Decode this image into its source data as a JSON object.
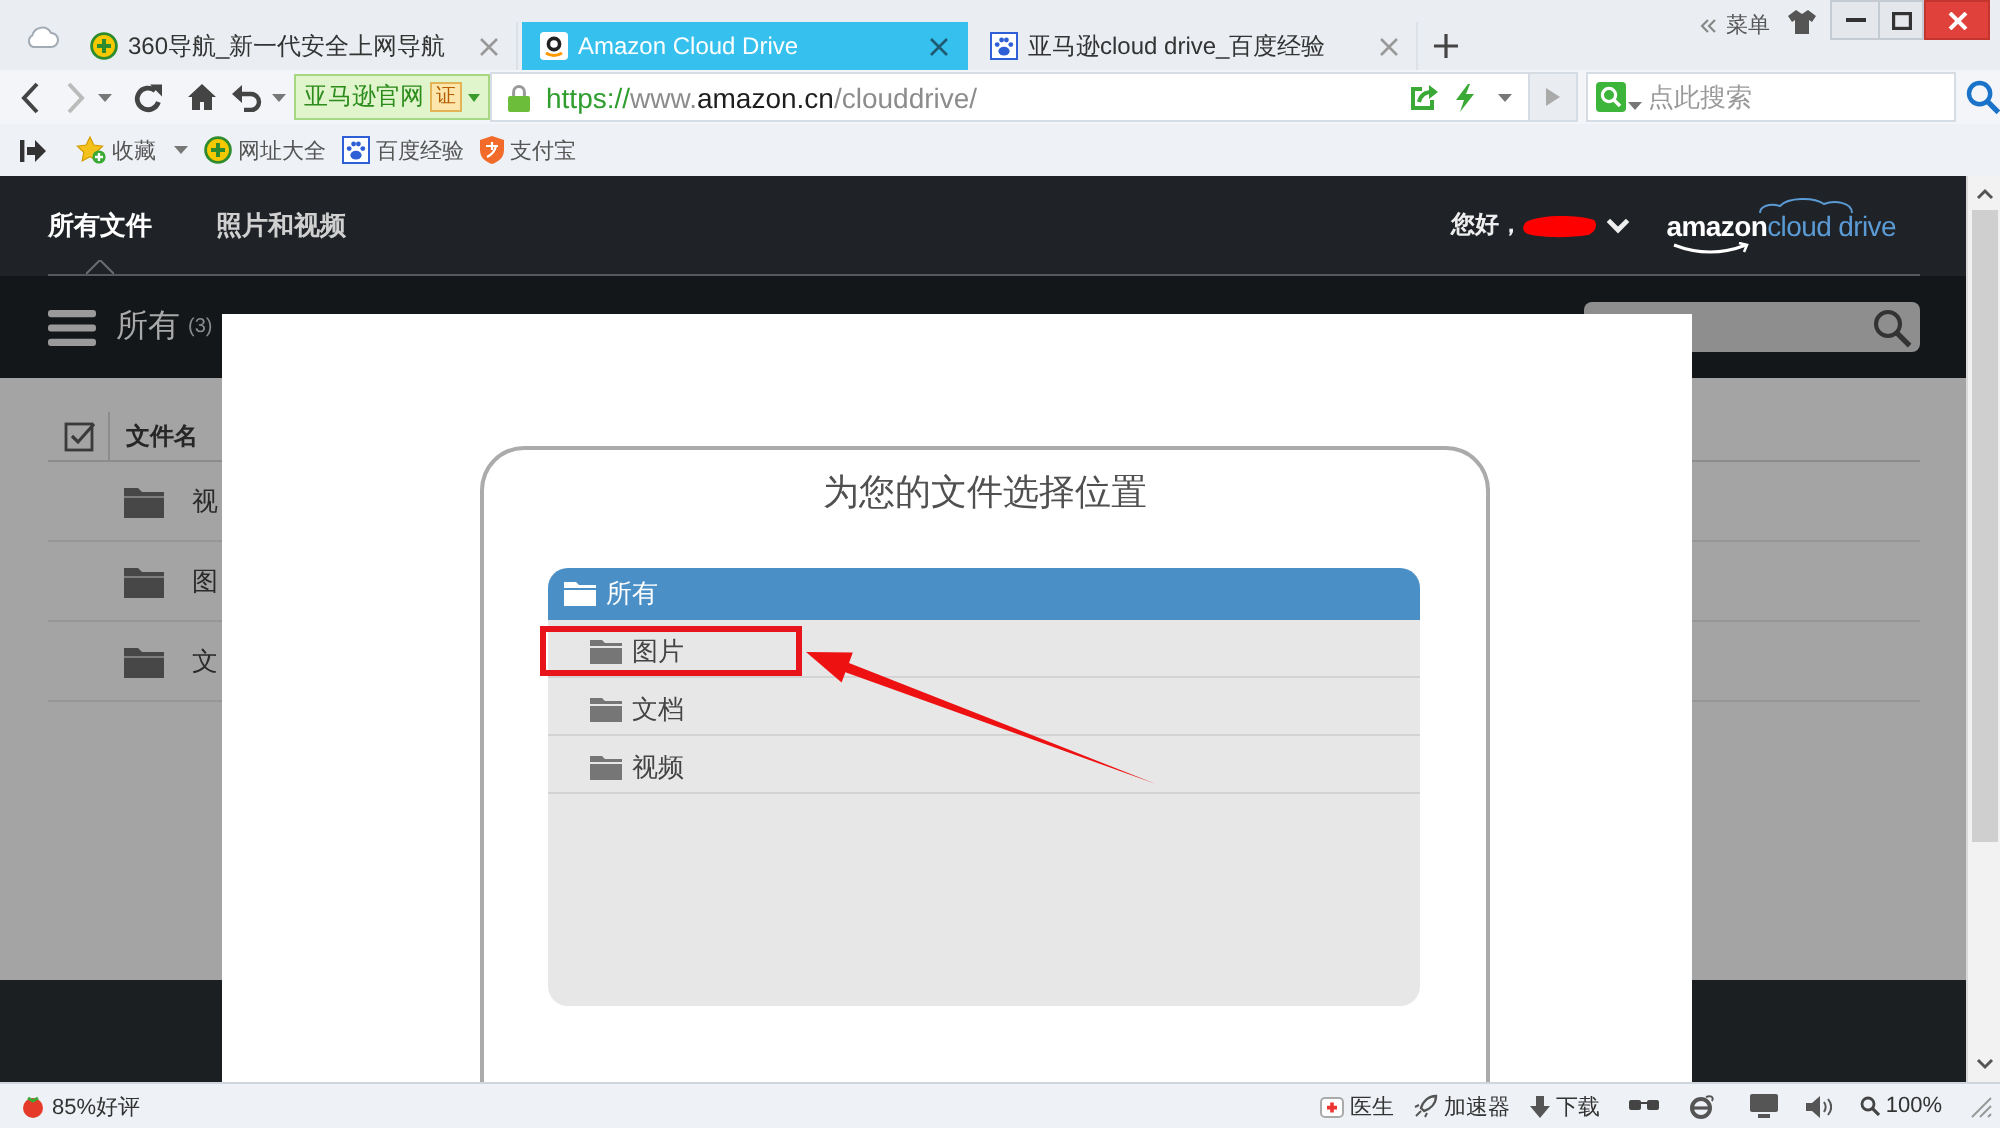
{
  "browser": {
    "tabs": [
      {
        "title": "360导航_新一代安全上网导航",
        "selected": false
      },
      {
        "title": "Amazon Cloud Drive",
        "selected": true
      },
      {
        "title": "亚马逊cloud drive_百度经验",
        "selected": false
      }
    ],
    "menu_label": "菜单",
    "nav_buttons": [
      {
        "kind": "back",
        "disabled": false
      },
      {
        "kind": "forward",
        "disabled": true
      }
    ],
    "site_badge": {
      "label": "亚马逊官网",
      "cert": "证"
    },
    "address": [
      {
        "text": "https://",
        "kind": "scheme"
      },
      {
        "text": "www.",
        "kind": "subdomain"
      },
      {
        "text": "amazon.cn",
        "kind": "domain"
      },
      {
        "text": "/clouddrive/",
        "kind": "path"
      }
    ],
    "search": {
      "placeholder": "点此搜索"
    },
    "bookmarks": [
      {
        "label": "收藏",
        "kind": "menu"
      },
      {
        "label": "网址大全",
        "kind": "link"
      },
      {
        "label": "百度经验",
        "kind": "link"
      },
      {
        "label": "支付宝",
        "kind": "link"
      }
    ]
  },
  "page": {
    "nav": [
      {
        "label": "所有文件",
        "selected": true
      },
      {
        "label": "照片和视频",
        "selected": false
      }
    ],
    "greeting": "您好，",
    "logo": {
      "brand": "amazon",
      "product": "cloud drive"
    },
    "folder": {
      "title": "所有",
      "count": "(3)"
    },
    "columns": [
      "文件名"
    ],
    "files": [
      "视",
      "图",
      "文"
    ],
    "dialog": {
      "title": "为您的文件选择位置",
      "tree": {
        "label": "所有",
        "selected": true,
        "highlighted": false,
        "children": [
          {
            "label": "图片",
            "selected": false,
            "highlighted": true
          },
          {
            "label": "文档",
            "selected": false,
            "highlighted": false
          },
          {
            "label": "视频",
            "selected": false,
            "highlighted": false
          }
        ]
      }
    }
  },
  "status_bar": {
    "rating": "85%好评",
    "tools": [
      "医生",
      "加速器",
      "下载"
    ],
    "zoom": "100%"
  }
}
